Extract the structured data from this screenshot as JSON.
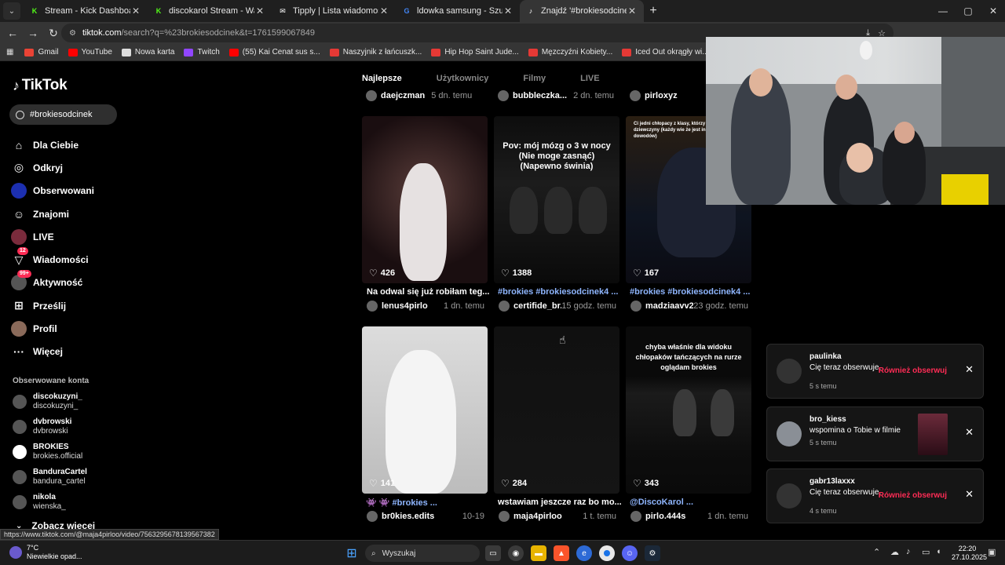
{
  "browser": {
    "tabs": [
      {
        "title": "Stream - Kick Dashboard",
        "color": "#53fc18",
        "glyph": "K"
      },
      {
        "title": "discokarol Stream - Watch Live",
        "color": "#53fc18",
        "glyph": "K"
      },
      {
        "title": "Tipply | Lista wiadomości",
        "color": "#ffffff",
        "glyph": "✉"
      },
      {
        "title": "ldowka samsung - Szukaj w Go",
        "color": "#4285f4",
        "glyph": "G"
      },
      {
        "title": "Znajdź '#brokiesodcinek' na Tik",
        "color": "#ffffff",
        "glyph": "♪"
      }
    ],
    "url_host": "tiktok.com",
    "url_path": "/search?q=%23brokiesodcinek&t=1761599067849",
    "bookmarks": [
      {
        "label": "Gmail",
        "color": "#ea4335"
      },
      {
        "label": "YouTube",
        "color": "#ff0000"
      },
      {
        "label": "Nowa karta",
        "color": "#dddddd"
      },
      {
        "label": "Twitch",
        "color": "#9146ff"
      },
      {
        "label": "(55) Kai Cenat sus s...",
        "color": "#ff0000"
      },
      {
        "label": "Naszyjnik z łańcuszk...",
        "color": "#e53935"
      },
      {
        "label": "Hip Hop Saint Jude...",
        "color": "#e53935"
      },
      {
        "label": "Męzczyźni Kobiety...",
        "color": "#e53935"
      },
      {
        "label": "Iced Out okrągły wi...",
        "color": "#e53935"
      }
    ],
    "status_url": "https://www.tiktok.com/@maja4pirloo/video/7563295678139567382"
  },
  "tiktok": {
    "logo": "TikTok",
    "search_value": "#brokiesodcinek",
    "nav": [
      {
        "label": "Dla Ciebie",
        "icon": "home-icon"
      },
      {
        "label": "Odkryj",
        "icon": "compass-icon"
      },
      {
        "label": "Obserwowani",
        "icon": "following-avatar"
      },
      {
        "label": "Znajomi",
        "icon": "friends-icon"
      },
      {
        "label": "LIVE",
        "icon": "live-avatar"
      },
      {
        "label": "Wiadomości",
        "icon": "messages-icon",
        "badge": "12"
      },
      {
        "label": "Aktywność",
        "icon": "activity-icon",
        "badge": "99+"
      },
      {
        "label": "Prześlij",
        "icon": "upload-icon"
      },
      {
        "label": "Profil",
        "icon": "profile-avatar"
      },
      {
        "label": "Więcej",
        "icon": "more-icon"
      }
    ],
    "followed_title": "Obserwowane konta",
    "followed": [
      {
        "name": "discokuzyni_",
        "handle": "discokuzyni_"
      },
      {
        "name": "dvbrowski",
        "handle": "dvbrowski"
      },
      {
        "name": "BROKIES",
        "handle": "brokies.official"
      },
      {
        "name": "BanduraCartel",
        "handle": "bandura_cartel"
      },
      {
        "name": "nikola",
        "handle": "wienska_"
      }
    ],
    "see_more": "Zobacz więcej",
    "result_tabs": [
      "Najlepsze",
      "Użytkownicy",
      "Filmy",
      "LIVE"
    ],
    "top_row": [
      {
        "author": "daejczman",
        "time": "5 dn. temu"
      },
      {
        "author": "bubbleczka...",
        "time": "2 dn. temu"
      },
      {
        "author": "pirloxyz",
        "time": ""
      }
    ],
    "videos": [
      {
        "likes": "426",
        "title": "Na odwal się już robiłam teg...",
        "author": "lenus4pirlo",
        "time": "1 dn. temu",
        "tag": false,
        "overlay": ""
      },
      {
        "likes": "1388",
        "title": "#brokies #brokiesodcinek4 ...",
        "author": "certifide_br...",
        "time": "15 godz. temu",
        "tag": true,
        "overlay": "Pov: mój mózg o 3 w nocy\n(Nie moge zasnąć)\n(Napewno świnia)"
      },
      {
        "likes": "167",
        "title": "#brokies #brokiesodcinek4 ...",
        "author": "madziaavv2",
        "time": "23 godz. temu",
        "tag": true,
        "overlay": "Ci jedni chłopacy z klasy, którzy za\ndziewczyny (każdy wie że jest in\ndowodów)"
      },
      {
        "likes": "141",
        "title": "👾 👾 #brokies ...",
        "author": "br0kies.edits",
        "time": "10-19",
        "tag": true,
        "overlay": ""
      },
      {
        "likes": "284",
        "title": "wstawiam jeszcze raz bo mo...",
        "author": "maja4pirloo",
        "time": "1 t. temu",
        "tag": false,
        "overlay": ""
      },
      {
        "likes": "343",
        "title": "@DiscoKarol ...",
        "author": "pirlo.444s",
        "time": "1 dn. temu",
        "tag": true,
        "overlay": "chyba właśnie dla widoku\nchłopaków tańczących na rurze\noglądam brokies"
      }
    ]
  },
  "notifications": [
    {
      "user": "paulinka",
      "message": "Cię teraz obserwuje.",
      "time": "5 s temu",
      "action": "Również obserwuj"
    },
    {
      "user": "bro_kiess",
      "message": "wspomina o Tobie w filmie",
      "time": "5 s temu",
      "action": ""
    },
    {
      "user": "gabr13laxxx",
      "message": "Cię teraz obserwuje.",
      "time": "4 s temu",
      "action": "Również obserwuj"
    }
  ],
  "taskbar": {
    "temp": "7°C",
    "weather": "Niewielkie opad...",
    "search": "Wyszukaj",
    "time": "22:20",
    "date": "27.10.2025"
  },
  "colors": {
    "accent": "#fe2c55",
    "tag": "#8fb6ff",
    "background": "#000000"
  }
}
